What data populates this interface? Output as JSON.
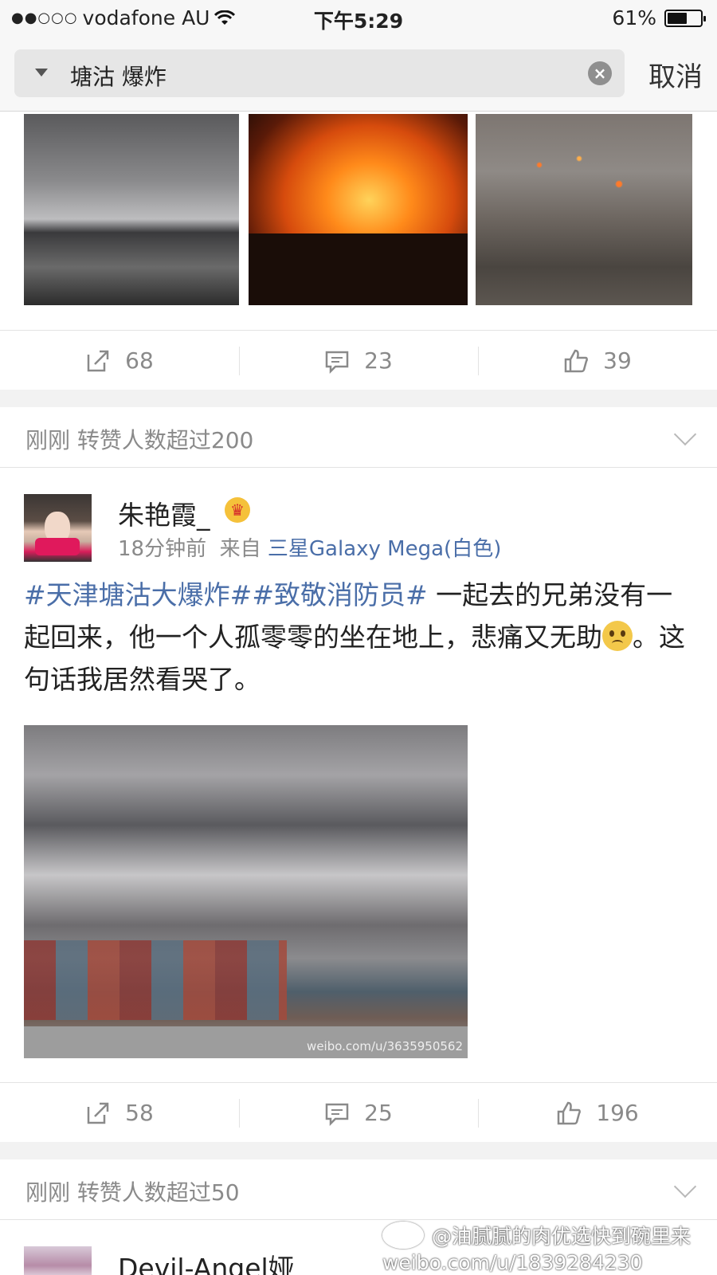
{
  "status_bar": {
    "signal": "●●○○○",
    "carrier": "vodafone AU",
    "time": "下午5:29",
    "battery_percent": "61%",
    "battery_level": 0.61
  },
  "search": {
    "query": "塘沽 爆炸",
    "cancel_label": "取消"
  },
  "post1": {
    "actions": {
      "repost": "68",
      "comment": "23",
      "like": "39"
    }
  },
  "section1": {
    "text": "刚刚 转赞人数超过200"
  },
  "post2": {
    "username": "朱艳霞_",
    "time": "18分钟前",
    "from_label": "来自",
    "source": "三星Galaxy Mega(白色)",
    "hashtag1": "#天津塘沽大爆炸#",
    "hashtag2": "#致敬消防员#",
    "text_before_emoji": " 一起去的兄弟没有一起回来，他一个人孤零零的坐在地上，悲痛又无助",
    "text_after_emoji": "。这句话我居然看哭了。",
    "image_watermark": "weibo.com/u/3635950562",
    "actions": {
      "repost": "58",
      "comment": "25",
      "like": "196"
    }
  },
  "section2": {
    "text": "刚刚 转赞人数超过50"
  },
  "post3": {
    "username": "Devil-Angel娅"
  },
  "watermark": {
    "line1": "@油腻腻的肉优选快到碗里来",
    "line2": "weibo.com/u/1839284230"
  }
}
